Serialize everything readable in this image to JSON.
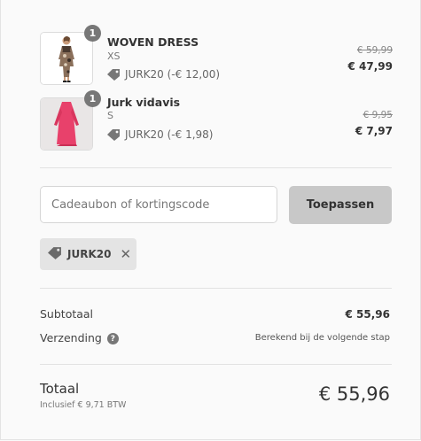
{
  "items": [
    {
      "quantity": "1",
      "name": "WOVEN DRESS",
      "variant": "XS",
      "discount": "JURK20 (-€ 12,00)",
      "price_original": "€ 59,99",
      "price_final": "€ 47,99"
    },
    {
      "quantity": "1",
      "name": "Jurk vidavis",
      "variant": "S",
      "discount": "JURK20 (-€ 1,98)",
      "price_original": "€ 9,95",
      "price_final": "€ 7,97"
    }
  ],
  "discount_form": {
    "placeholder": "Cadeaubon of kortingscode",
    "apply_label": "Toepassen"
  },
  "applied_code": {
    "code": "JURK20"
  },
  "summary": {
    "subtotal_label": "Subtotaal",
    "subtotal_value": "€ 55,96",
    "shipping_label": "Verzending",
    "shipping_value": "Berekend bij de volgende stap"
  },
  "total": {
    "label": "Totaal",
    "tax_note": "Inclusief € 9,71 BTW",
    "value": "€ 55,96"
  },
  "colors": {
    "background": "#fafafa",
    "button": "#c8c8c8",
    "badge": "#777777",
    "dress_pink": "#e8416b"
  }
}
